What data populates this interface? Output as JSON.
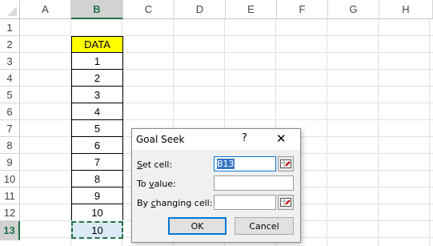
{
  "columns": [
    "A",
    "B",
    "C",
    "D",
    "E",
    "F",
    "G",
    "H"
  ],
  "selected_column": "B",
  "rows": [
    "1",
    "2",
    "3",
    "4",
    "5",
    "6",
    "7",
    "8",
    "9",
    "10",
    "11",
    "12",
    "13"
  ],
  "selected_row": "13",
  "data_header": "DATA",
  "data_values": [
    "1",
    "2",
    "3",
    "4",
    "5",
    "6",
    "7",
    "8",
    "9",
    "10",
    "10"
  ],
  "colors": {
    "header_fill": "#ffff00",
    "active_fill": "#dce9f7",
    "accent": "#217346"
  },
  "dialog": {
    "title": "Goal Seek",
    "help_glyph": "?",
    "close_glyph": "✕",
    "set_cell_label_u": "S",
    "set_cell_label_rest": "et cell:",
    "set_cell_value": "B13",
    "to_value_label_a": "To ",
    "to_value_label_u": "v",
    "to_value_label_b": "alue:",
    "to_value_value": "",
    "changing_label_a": "By ",
    "changing_label_u": "c",
    "changing_label_b": "hanging cell:",
    "changing_value": "",
    "ok_label": "OK",
    "cancel_label": "Cancel"
  }
}
